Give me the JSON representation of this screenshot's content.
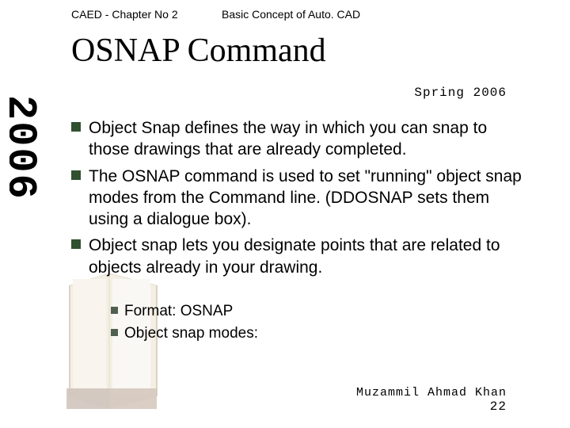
{
  "header": {
    "left": "CAED - Chapter No 2",
    "right": "Basic Concept of Auto. CAD"
  },
  "title": "OSNAP Command",
  "spring": "Spring 2006",
  "year_vertical": "2006",
  "bullets": [
    "Object Snap defines the way in which you can snap to those drawings that are already completed.",
    "The OSNAP command is used to set \"running\" object snap modes from the Command line. (DDOSNAP sets them using a dialogue box).",
    "Object snap lets you designate points that are related to objects already in your drawing."
  ],
  "sub_bullets": [
    "Format:  OSNAP",
    "Object snap modes:"
  ],
  "footer": {
    "author": "Muzammil Ahmad Khan",
    "page": "22"
  },
  "colors": {
    "bullet": "#305030"
  }
}
